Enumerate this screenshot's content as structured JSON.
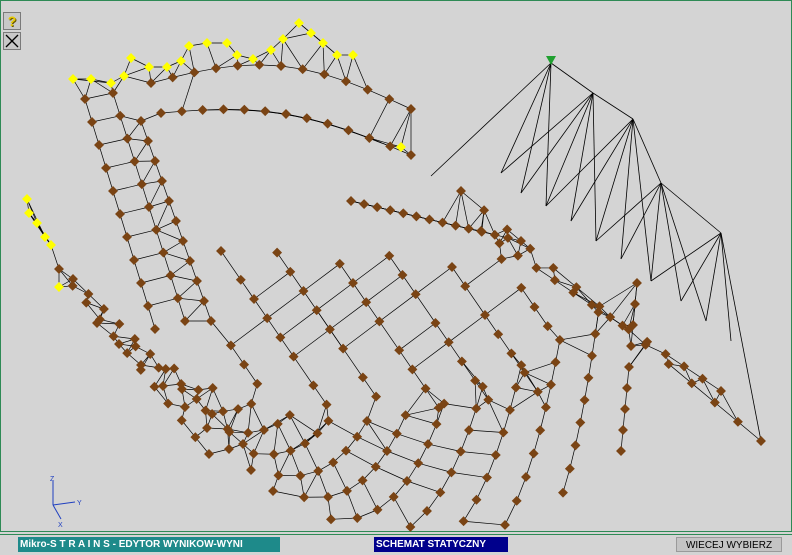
{
  "toolbar": {
    "help_glyph": "?",
    "close_glyph": "✕"
  },
  "axis": {
    "z": "Z",
    "y": "Y",
    "x": "X"
  },
  "status": {
    "title": "Mikro-S T R A I N S - EDYTOR WYNIKOW-WYNI",
    "schema": "SCHEMAT STATYCZNY",
    "more": "WIECEJ WYBIERZ"
  },
  "colors": {
    "background": "#d4d4d4",
    "mesh_line": "#000000",
    "node": "#7a4414",
    "selected_node": "#ffff00",
    "support": "#20a030",
    "frame": "#2e8a55"
  }
}
